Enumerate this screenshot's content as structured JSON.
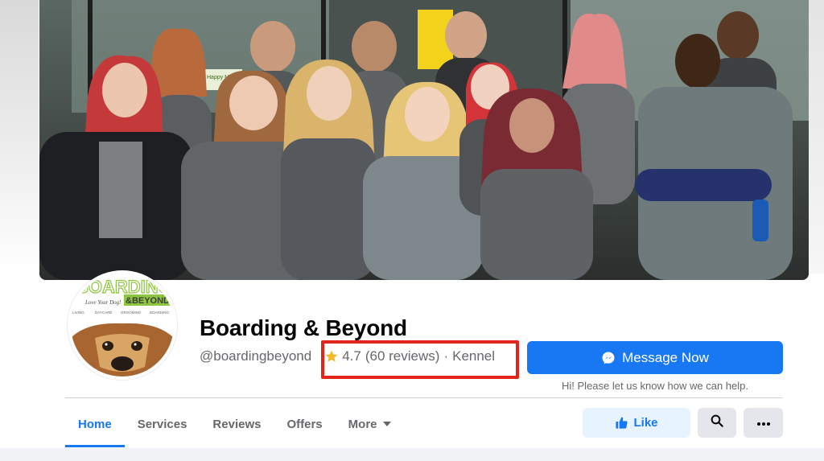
{
  "page": {
    "name": "Boarding & Beyond",
    "handle": "@boardingbeyond",
    "rating": "4.7",
    "reviews": "(60 reviews)",
    "separator": "·",
    "category": "Kennel"
  },
  "cover": {
    "sign_text": "Happy Mother's Day"
  },
  "avatar": {
    "logo_top": "BOARDING",
    "logo_and": "&BEYOND",
    "tagline": "Love Your Dog!",
    "services": [
      "LIVING",
      "DAYCARE",
      "GROOMING",
      "BOARDING"
    ]
  },
  "actions": {
    "message_label": "Message Now",
    "message_hint": "Hi! Please let us know how we can help.",
    "like_label": "Like"
  },
  "tabs": [
    {
      "label": "Home",
      "active": true
    },
    {
      "label": "Services",
      "active": false
    },
    {
      "label": "Reviews",
      "active": false
    },
    {
      "label": "Offers",
      "active": false
    },
    {
      "label": "More",
      "active": false
    }
  ],
  "colors": {
    "accent": "#1877f2",
    "highlight_box": "#e3241b",
    "star": "#f7b928",
    "brand_green": "#8cc63f"
  },
  "icons": {
    "rating": "star-icon",
    "message": "messenger-icon",
    "like": "thumbs-up-icon",
    "search": "search-icon",
    "more": "ellipsis-icon",
    "more_tab": "caret-down-icon"
  }
}
